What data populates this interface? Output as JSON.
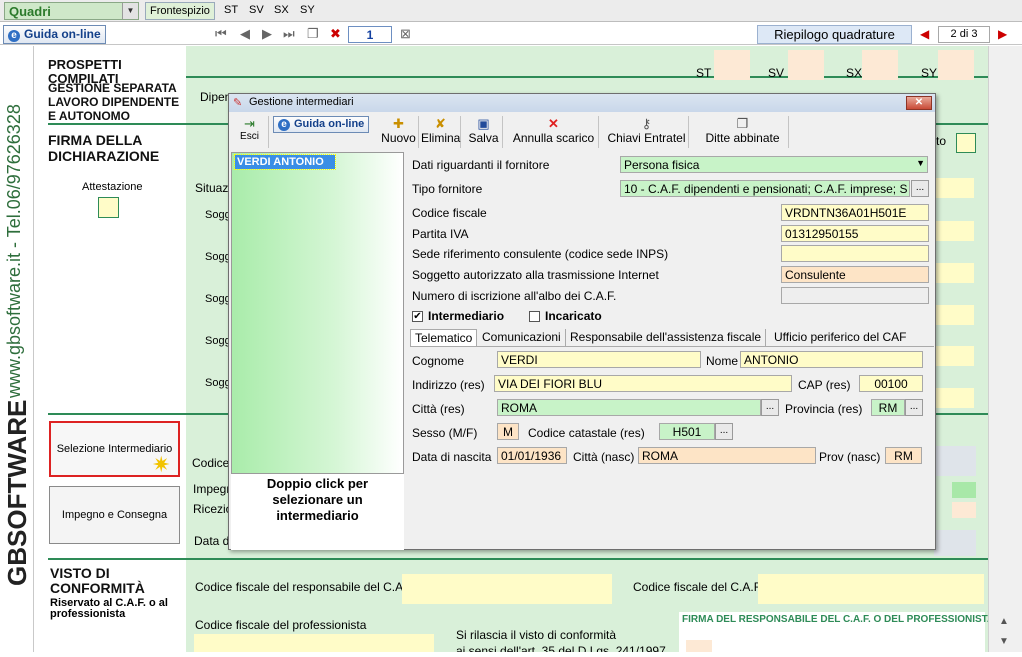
{
  "top": {
    "combo_value": "Quadri",
    "tabs": [
      "Frontespizio",
      "ST",
      "SV",
      "SX",
      "SY"
    ]
  },
  "toolbar2": {
    "guida_label": "Guida on-line",
    "page_input": "1",
    "riepilogo_label": "Riepilogo quadrature",
    "page_counter": "2 di 3"
  },
  "sidebar": {
    "vertical_text": "www.gbsoftware.it - Tel.06/97626328",
    "logo_text": "GBSOFTWARE"
  },
  "main": {
    "sec_prospetti": "PROSPETTI COMPILATI",
    "sec_gestione": "GESTIONE SEPARATA LAVORO DIPENDENTE E AUTONOMO",
    "col_labels": [
      "ST",
      "SV",
      "SX",
      "SY"
    ],
    "dipen_label": "Dipen",
    "firma_title": "FIRMA DELLA DICHIARAZIONE",
    "attestazione": "Attestazione",
    "situaz": "Situaz",
    "sogg_labels": [
      "Sogg",
      "Sogg",
      "Sogg",
      "Sogg",
      "Sogg"
    ],
    "to_label": "to",
    "btn_seleziona": "Selezione Intermediario",
    "btn_impegno": "Impegno e Consegna",
    "codice_label": "Codice",
    "impegn_label": "Impegn",
    "ricezi_label": "Ricezio",
    "datad_label": "Data d",
    "visto_title": "VISTO DI CONFORMITÀ",
    "visto_sub": "Riservato al C.A.F. o al professionista",
    "cf_resp_caf": "Codice fiscale del responsabile del C.A.F.",
    "cf_caf": "Codice fiscale del C.A.F.",
    "cf_prof": "Codice fiscale del professionista",
    "firma_resp": "FIRMA DEL RESPONSABILE DEL C.A.F. O DEL PROFESSIONISTA",
    "rilascia": "Si rilascia il visto di conformità",
    "rilascia2": "ai sensi dell'art. 35 del D.Lgs. 241/1997"
  },
  "dialog": {
    "title": "Gestione intermediari",
    "toolbar": {
      "esci": "Esci",
      "guida": "Guida on-line",
      "nuovo": "Nuovo",
      "elimina": "Elimina",
      "salva": "Salva",
      "annulla": "Annulla scarico",
      "chiavi": "Chiavi Entratel",
      "ditte": "Ditte abbinate"
    },
    "list": {
      "selected_item": "VERDI ANTONIO",
      "hint": "Doppio click per selezionare un intermediario"
    },
    "form": {
      "dati_label": "Dati riguardanti il fornitore",
      "dati_value": "Persona fisica",
      "tipo_label": "Tipo fornitore",
      "tipo_value": "10 - C.A.F. dipendenti e pensionati; C.A.F. imprese; S",
      "cf_label": "Codice fiscale",
      "cf_value": "VRDNTN36A01H501E",
      "piva_label": "Partita IVA",
      "piva_value": "01312950155",
      "sede_label": "Sede riferimento consulente (codice sede INPS)",
      "sede_value": "",
      "sogg_label": "Soggetto autorizzato alla trasmissione Internet",
      "sogg_value": "Consulente",
      "num_label": "Numero di iscrizione all'albo dei C.A.F.",
      "num_value": "",
      "intermediario_label": "Intermediario",
      "intermediario_checked": "✔",
      "incaricato_label": "Incaricato",
      "incaricato_checked": ""
    },
    "inner_tabs": [
      "Telematico",
      "Comunicazioni",
      "Responsabile dell'assistenza fiscale",
      "Ufficio periferico del CAF"
    ],
    "tele": {
      "cognome_label": "Cognome",
      "cognome_value": "VERDI",
      "nome_label": "Nome",
      "nome_value": "ANTONIO",
      "indirizzo_label": "Indirizzo (res)",
      "indirizzo_value": "VIA DEI FIORI BLU",
      "cap_label": "CAP (res)",
      "cap_value": "00100",
      "citta_label": "Città (res)",
      "citta_value": "ROMA",
      "prov_label": "Provincia (res)",
      "prov_value": "RM",
      "sesso_label": "Sesso (M/F)",
      "sesso_value": "M",
      "catastale_label": "Codice catastale (res)",
      "catastale_value": "H501",
      "nascita_label": "Data di nascita",
      "nascita_value": "01/01/1936",
      "cittanasc_label": "Città (nasc)",
      "cittanasc_value": "ROMA",
      "provnasc_label": "Prov (nasc)",
      "provnasc_value": "RM"
    }
  }
}
